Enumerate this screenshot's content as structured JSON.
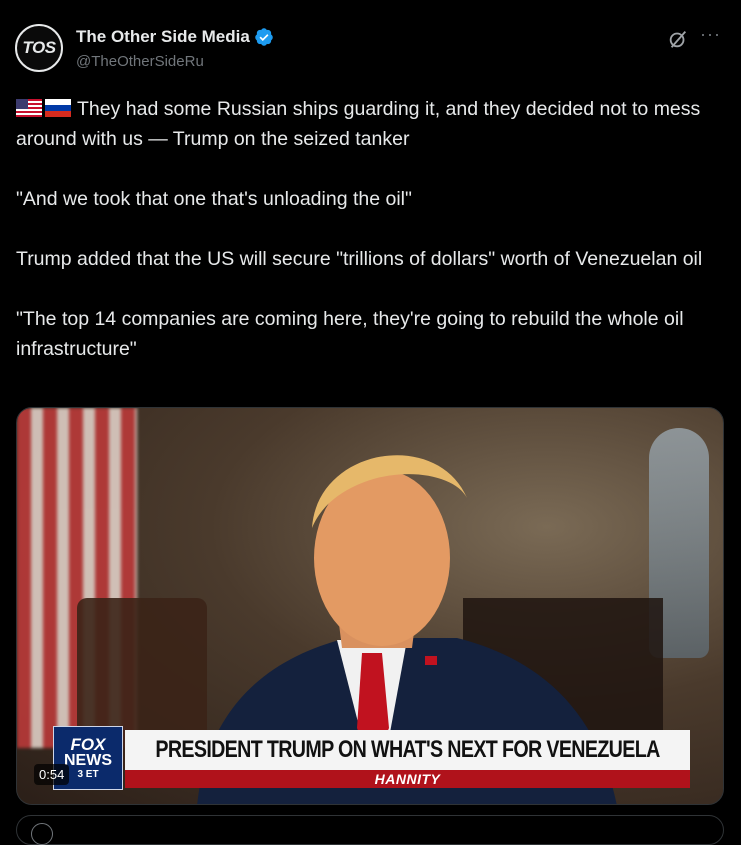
{
  "author": {
    "name": "The Other Side Media",
    "handle": "@TheOtherSideRu",
    "avatar_text": "TOS",
    "verified": true,
    "verified_color": "#1d9bf0"
  },
  "icons": {
    "grok": "grok-icon",
    "more": "more-icon",
    "verified": "verified-badge-icon",
    "flag_us": "flag-us-icon",
    "flag_ru": "flag-ru-icon"
  },
  "tweet": {
    "line1": "They had some Russian ships guarding it, and they decided not to mess around with us — Trump on the seized tanker",
    "line2": "\"And we took that one that's unloading the oil\"",
    "line3": "Trump added that the US will secure \"trillions of dollars\" worth of Venezuelan oil",
    "line4": "\"The top 14 companies are coming here, they're going to rebuild the whole oil infrastructure\""
  },
  "media": {
    "duration": "0:54",
    "network_logo_top": "FOX",
    "network_logo_mid": "NEWS",
    "network_logo_bottom": "3 ET",
    "headline": "PRESIDENT TRUMP ON WHAT'S NEXT FOR VENEZUELA",
    "show": "HANNITY"
  },
  "more_label": "···"
}
